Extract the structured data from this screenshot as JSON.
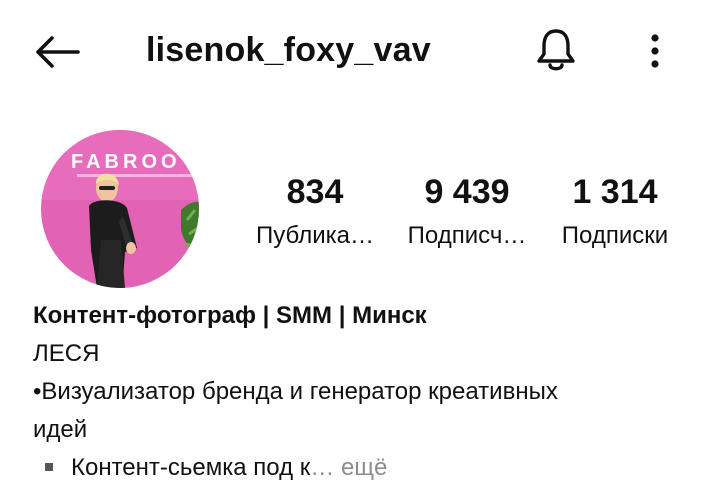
{
  "header": {
    "username": "lisenok_foxy_vav",
    "back_icon": "arrow-left-icon",
    "bell_icon": "bell-icon",
    "more_icon": "more-vertical-icon"
  },
  "profile": {
    "avatar_sign_text": "FABROO",
    "stats": [
      {
        "value": "834",
        "label": "Публика…"
      },
      {
        "value": "9 439",
        "label": "Подписч…"
      },
      {
        "value": "1 314",
        "label": "Подписки"
      }
    ]
  },
  "bio": {
    "title": "Контент-фотограф | SMM | Минск",
    "line1": "ЛЕСЯ",
    "line2": "•Визуализатор бренда и генератор креативных",
    "line3": "идей",
    "line4": "Контент-сьемка под к",
    "more_label": "… ещё"
  },
  "colors": {
    "avatar_bg": "#e262b4",
    "text": "#111111",
    "muted": "#8e8e8e"
  }
}
